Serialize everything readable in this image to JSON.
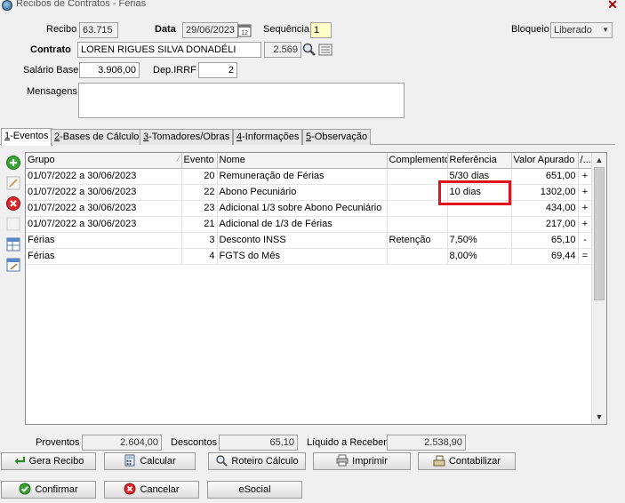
{
  "window": {
    "title": "Recibos de Contratos - Férias",
    "close": "✕"
  },
  "header": {
    "recibo_label": "Recibo",
    "recibo_value": "63.715",
    "data_label": "Data",
    "data_value": "29/06/2023",
    "sequencia_label": "Sequência",
    "sequencia_value": "1",
    "bloqueio_label": "Bloqueio",
    "bloqueio_value": "Liberado",
    "contrato_label": "Contrato",
    "contrato_name": "LOREN RIGUES SILVA DONADÉLI",
    "contrato_code": "2.569",
    "salario_label": "Salário Base",
    "salario_value": "3.906,00",
    "depirrf_label": "Dep.IRRF",
    "depirrf_value": "2",
    "mensagens_label": "Mensagens",
    "mensagens_value": ""
  },
  "tabs": [
    {
      "key": "1",
      "rest": "-Eventos"
    },
    {
      "key": "2",
      "rest": "-Bases de Cálculo"
    },
    {
      "key": "3",
      "rest": "-Tomadores/Obras"
    },
    {
      "key": "4",
      "rest": "-Informações"
    },
    {
      "key": "5",
      "rest": "-Observação"
    }
  ],
  "grid": {
    "columns": [
      "Grupo",
      "Evento",
      "Nome",
      "Complemento",
      "Referência",
      "Valor Apurado",
      "/..."
    ],
    "rows": [
      [
        "01/07/2022 a 30/06/2023",
        "20",
        "Remuneração de Férias",
        "",
        "5/30 dias",
        "651,00",
        "+"
      ],
      [
        "01/07/2022 a 30/06/2023",
        "22",
        "Abono Pecuniário",
        "",
        "10 dias",
        "1302,00",
        "+"
      ],
      [
        "01/07/2022 a 30/06/2023",
        "23",
        "Adicional 1/3 sobre Abono Pecuniário",
        "",
        "",
        "434,00",
        "+"
      ],
      [
        "01/07/2022 a 30/06/2023",
        "21",
        "Adicional de 1/3 de Férias",
        "",
        "",
        "217,00",
        "+"
      ],
      [
        "Férias",
        "3",
        "Desconto INSS",
        "Retenção",
        "7,50%",
        "65,10",
        "-"
      ],
      [
        "Férias",
        "4",
        "FGTS do Mês",
        "",
        "8,00%",
        "69,44",
        "="
      ]
    ]
  },
  "totals": {
    "proventos_label": "Proventos",
    "proventos_value": "2.604,00",
    "descontos_label": "Descontos",
    "descontos_value": "65,10",
    "liquido_label": "Líquido a Receber",
    "liquido_value": "2.538,90"
  },
  "buttons": {
    "gera_recibo": "Gera Recibo",
    "calcular": "Calcular",
    "roteiro": "Roteiro Cálculo",
    "imprimir": "Imprimir",
    "contabilizar": "Contabilizar",
    "confirmar": "Confirmar",
    "cancelar": "Cancelar",
    "esocial": "eSocial"
  }
}
